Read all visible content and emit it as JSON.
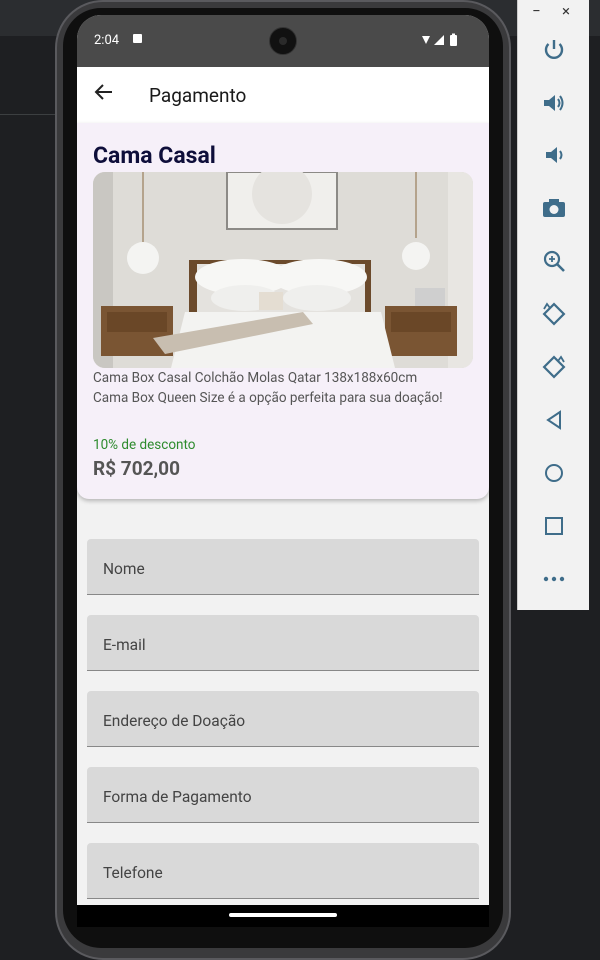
{
  "status_bar": {
    "time": "2:04"
  },
  "app_bar": {
    "title": "Pagamento"
  },
  "product": {
    "title": "Cama Casal",
    "description_line1": "Cama Box Casal Colchão Molas Qatar 138x188x60cm",
    "description_line2": "Cama Box Queen Size é a opção perfeita para sua doação!",
    "discount": "10% de desconto",
    "price": "R$ 702,00"
  },
  "form": {
    "fields": [
      {
        "label": "Nome"
      },
      {
        "label": "E-mail"
      },
      {
        "label": "Endereço de Doação"
      },
      {
        "label": "Forma de Pagamento"
      },
      {
        "label": "Telefone"
      }
    ]
  },
  "emulator_panel": {
    "minimize_label": "−",
    "close_label": "×",
    "buttons": [
      "power-icon",
      "volume-up-icon",
      "volume-down-icon",
      "camera-icon",
      "zoom-in-icon",
      "rotate-left-icon",
      "rotate-right-icon",
      "back-icon",
      "home-icon",
      "overview-icon",
      "more-icon"
    ]
  },
  "colors": {
    "accent_discount": "#2e8b2e",
    "title": "#0e0e3a",
    "card_bg": "#f6f0f9",
    "field_bg": "#d9d9d9"
  }
}
